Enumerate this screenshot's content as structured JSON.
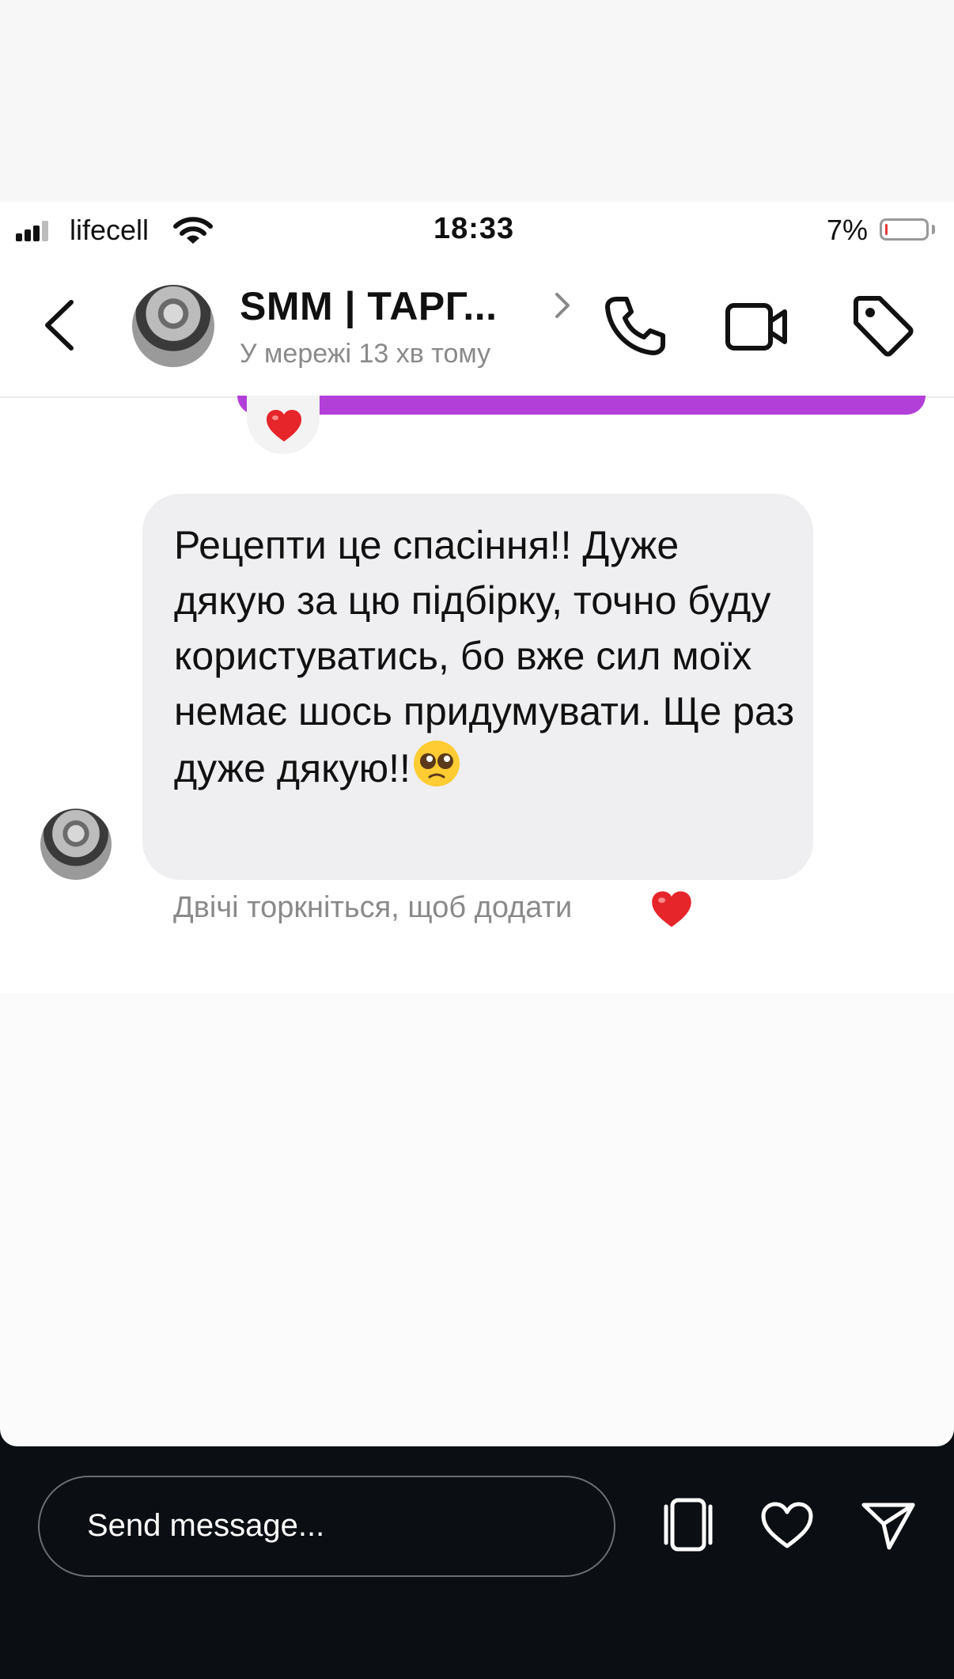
{
  "status_bar": {
    "carrier": "lifecell",
    "time": "18:33",
    "battery_percent": "7%",
    "battery_level": 0.07,
    "battery_color": "#e53935"
  },
  "header": {
    "chat_name": "SMM | ТАРГ...",
    "presence": "У мережі 13 хв тому",
    "icons": [
      "back-chevron-icon",
      "phone-icon",
      "video-camera-icon",
      "tag-icon"
    ]
  },
  "messages": {
    "sent_reaction": "❤️",
    "sent_bubble_color": "#b33fd9",
    "received_text": "Рецепти це спасіння!! Дуже дякую за цю підбірку, точно буду користуватись, бо вже сил моїх немає шось придумувати. Ще раз дуже дякую!!",
    "received_emoji": "pleading-face",
    "double_tap_hint": "Двічі торкніться, щоб додати"
  },
  "reply_bar": {
    "placeholder": "Send message...",
    "icons": [
      "share-card-icon",
      "heart-icon",
      "send-icon"
    ]
  }
}
